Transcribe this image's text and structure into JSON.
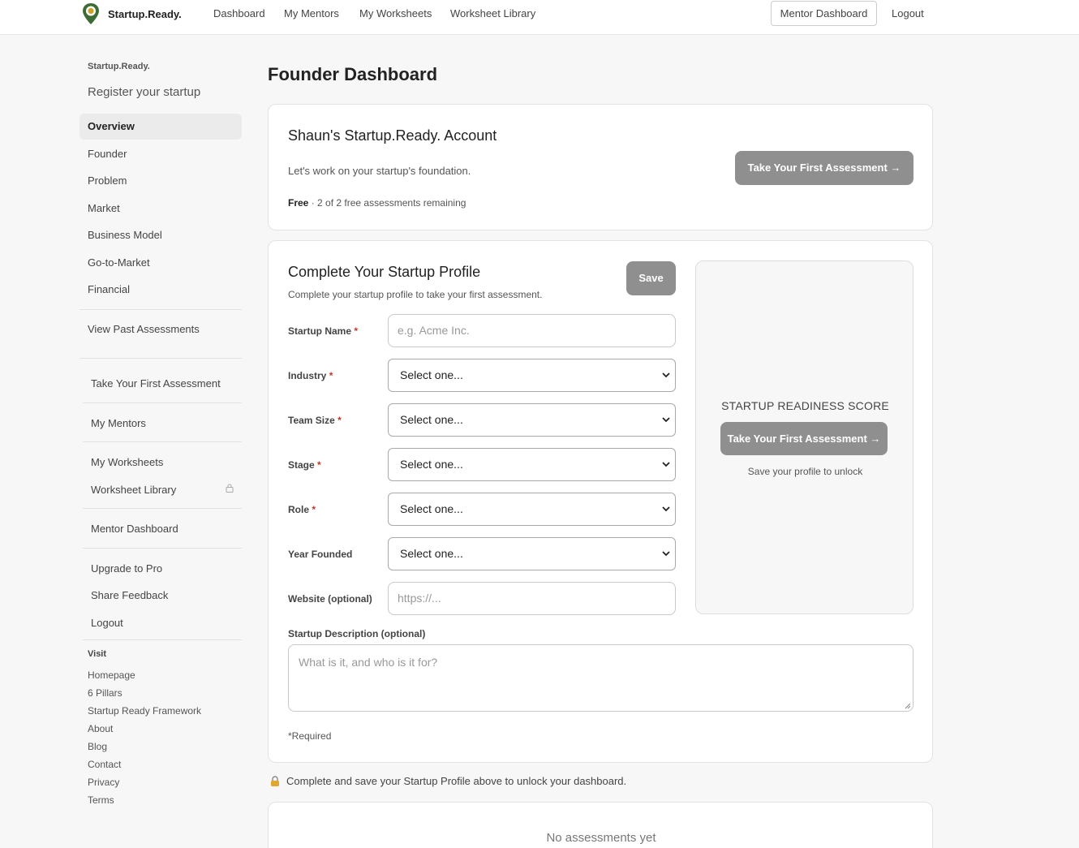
{
  "nav": {
    "logo_text": "Startup.Ready.",
    "links": [
      "Dashboard",
      "My Mentors",
      "My Worksheets",
      "Worksheet Library"
    ],
    "mentor_dashboard": "Mentor Dashboard",
    "logout": "Logout"
  },
  "sidebar": {
    "brand": "Startup.Ready.",
    "register": "Register your startup",
    "items": [
      "Overview",
      "Founder",
      "Problem",
      "Market",
      "Business Model",
      "Go-to-Market",
      "Financial"
    ],
    "view_past": "View Past Assessments",
    "take_first": "Take Your First Assessment",
    "my_mentors": "My Mentors",
    "my_worksheets": "My Worksheets",
    "worksheet_library": "Worksheet Library",
    "mentor_dashboard": "Mentor Dashboard",
    "upgrade": "Upgrade to Pro",
    "feedback": "Share Feedback",
    "logout": "Logout",
    "visit_label": "Visit",
    "footer_links": [
      "Homepage",
      "6 Pillars",
      "Startup Ready Framework",
      "About",
      "Blog",
      "Contact",
      "Privacy",
      "Terms"
    ]
  },
  "main": {
    "title": "Founder Dashboard",
    "account": {
      "title": "Shaun's Startup.Ready. Account",
      "subtitle": "Let's work on your startup's foundation.",
      "plan": "Free",
      "remaining": " · 2 of 2 free assessments remaining",
      "cta": "Take Your First Assessment →"
    },
    "profile": {
      "title": "Complete Your Startup Profile",
      "subtitle": "Complete your startup profile to take your first assessment.",
      "save": "Save",
      "fields": {
        "startup_name": {
          "label": "Startup Name",
          "placeholder": "e.g. Acme Inc."
        },
        "industry": {
          "label": "Industry",
          "value": "Select one..."
        },
        "team_size": {
          "label": "Team Size",
          "value": "Select one..."
        },
        "stage": {
          "label": "Stage",
          "value": "Select one..."
        },
        "role": {
          "label": "Role",
          "value": "Select one..."
        },
        "year_founded": {
          "label": "Year Founded",
          "value": "Select one..."
        },
        "website": {
          "label": "Website (optional)",
          "placeholder": "https://..."
        }
      },
      "required_mark": "*",
      "description_label": "Startup Description (optional)",
      "description_placeholder": "What is it, and who is it for?",
      "required_note": "*Required"
    },
    "score": {
      "title": "STARTUP READINESS SCORE",
      "cta": "Take Your First Assessment →",
      "note": "Save your profile to unlock"
    },
    "unlock_note": "Complete and save your Startup Profile above to unlock your dashboard.",
    "no_assessments": "No assessments yet"
  },
  "colors": {
    "button_grey": "#8f8f8f",
    "required_red": "#c0392b",
    "brand_green": "#3d6b35"
  }
}
